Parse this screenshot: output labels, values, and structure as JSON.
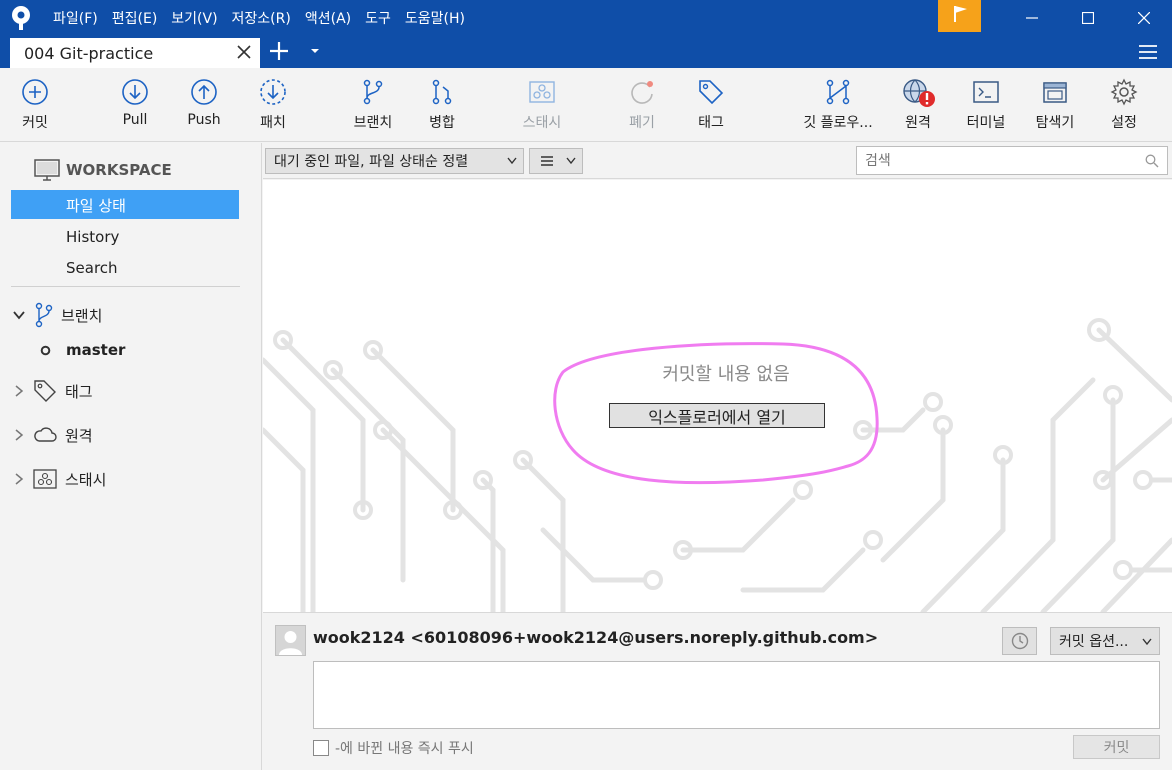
{
  "menu": [
    "파일(F)",
    "편집(E)",
    "보기(V)",
    "저장소(R)",
    "액션(A)",
    "도구",
    "도움말(H)"
  ],
  "tab": {
    "title": "004 Git-practice"
  },
  "toolbar": {
    "commit": "커밋",
    "pull": "Pull",
    "push": "Push",
    "fetch": "패치",
    "branch": "브랜치",
    "merge": "병합",
    "stash": "스태시",
    "discard": "폐기",
    "tag": "태그",
    "gitflow": "깃 플로우...",
    "remote": "원격",
    "terminal": "터미널",
    "explorer": "탐색기",
    "settings": "설정"
  },
  "sidebar": {
    "workspace": "WORKSPACE",
    "items": [
      "파일 상태",
      "History",
      "Search"
    ],
    "branches": "브랜치",
    "current_branch": "master",
    "tags": "태그",
    "remotes": "원격",
    "stashes": "스태시"
  },
  "filter": {
    "sort_label": "대기 중인 파일, 파일 상태순 정렬",
    "search_placeholder": "검색"
  },
  "main": {
    "empty_message": "커밋할 내용 없음",
    "open_explorer": "익스플로러에서 열기"
  },
  "commit": {
    "author": "wook2124  <60108096+wook2124@users.noreply.github.com>",
    "options": "커밋 옵션...",
    "push_immediately": "-에 바뀐 내용 즉시 푸시",
    "commit_button": "커밋"
  },
  "colors": {
    "titlebar": "#0f4ea8",
    "flag": "#f6a21a",
    "selection": "#3fa0f5",
    "annotation": "#f07cf0"
  }
}
